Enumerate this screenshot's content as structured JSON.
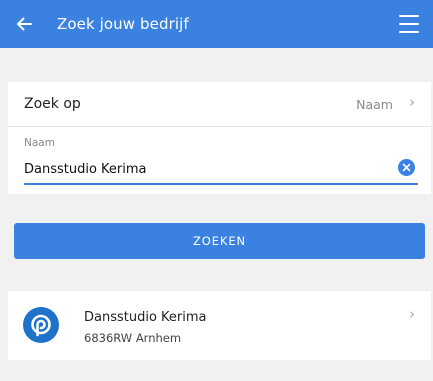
{
  "appbar": {
    "title": "Zoek jouw bedrijf",
    "back_icon": "arrow-left-icon",
    "menu_icon": "hamburger-menu-icon"
  },
  "search": {
    "zoek_op_label": "Zoek op",
    "zoek_op_value": "Naam",
    "chevron": "›",
    "field_label": "Naam",
    "field_value": "Dansstudio Kerima",
    "clear_icon": "clear-x-icon"
  },
  "zoeken_button": "ZOEKEN",
  "results": [
    {
      "name": "Dansstudio Kerima",
      "address": "6836RW Arnhem",
      "logo_icon": "company-logo-icon",
      "chevron": "›"
    }
  ],
  "colors": {
    "primary": "#3b82e0",
    "background": "#f1f1f2",
    "logo": "#1d73c9"
  }
}
